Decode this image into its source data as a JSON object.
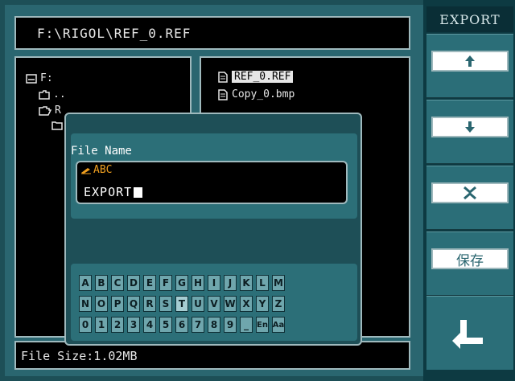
{
  "path": "F:\\RIGOL\\REF_0.REF",
  "tree": {
    "items": [
      {
        "label": "F:"
      },
      {
        "label": ".."
      },
      {
        "label": "R"
      },
      {
        "label": ""
      }
    ]
  },
  "files": [
    {
      "name": "REF_0.REF",
      "selected": true
    },
    {
      "name": "Copy_0.bmp",
      "selected": false
    }
  ],
  "status": "File Size:1.02MB",
  "dialog": {
    "label": "File Name",
    "ime": "ABC",
    "value": "EXPORT"
  },
  "keyboard": {
    "rows": [
      [
        "A",
        "B",
        "C",
        "D",
        "E",
        "F",
        "G",
        "H",
        "I",
        "J",
        "K",
        "L",
        "M"
      ],
      [
        "N",
        "O",
        "P",
        "Q",
        "R",
        "S",
        "T",
        "U",
        "V",
        "W",
        "X",
        "Y",
        "Z"
      ],
      [
        "0",
        "1",
        "2",
        "3",
        "4",
        "5",
        "6",
        "7",
        "8",
        "9",
        "_",
        "En",
        "Aa"
      ]
    ],
    "highlighted": "T"
  },
  "menu": {
    "title": "EXPORT",
    "items": [
      {
        "icon": "up-arrow-icon"
      },
      {
        "icon": "down-arrow-icon"
      },
      {
        "icon": "delete-x-icon"
      },
      {
        "label": "保存"
      }
    ],
    "back_icon": "return-arrow-icon"
  },
  "colors": {
    "background": "#2a6670",
    "panel": "#000000",
    "frame": "#9fb9bd",
    "ime_text": "#f0a020",
    "key": "#6fa6ad"
  }
}
